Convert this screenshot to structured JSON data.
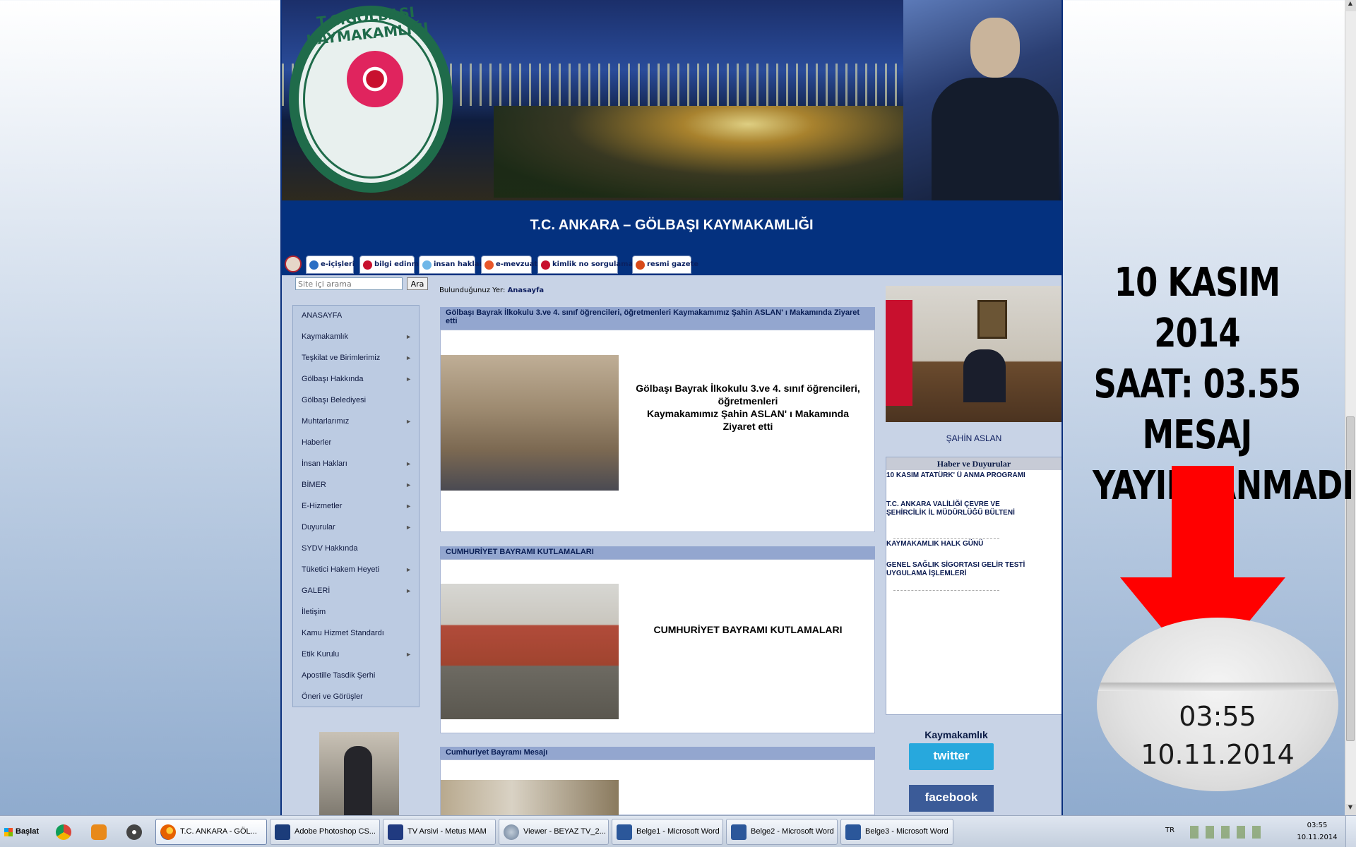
{
  "site": {
    "seal_text": "T.C.GÖLBAŞI KAYMAKAMLIĞI",
    "title": "T.C. ANKARA – GÖLBAŞI KAYMAKAMLIĞI",
    "quick_links": [
      {
        "label": "e-içişleri",
        "color": "#2b6fc4"
      },
      {
        "label": "bilgi edinme",
        "color": "#c8102e"
      },
      {
        "label": "insan hakları",
        "color": "#6fb7e8"
      },
      {
        "label": "e-mevzuat",
        "color": "#e8572a"
      },
      {
        "label": "kimlik no sorgulama",
        "color": "#c8102e"
      },
      {
        "label": "resmi gazete",
        "color": "#d84a1a"
      }
    ],
    "search": {
      "placeholder": "Site içi arama",
      "button": "Ara"
    },
    "menu": [
      {
        "label": "ANASAYFA",
        "arrow": ""
      },
      {
        "label": "Kaymakamlık",
        "arrow": "►"
      },
      {
        "label": "Teşkilat ve Birimlerimiz",
        "arrow": "►"
      },
      {
        "label": "Gölbaşı Hakkında",
        "arrow": "►"
      },
      {
        "label": "Gölbaşı Belediyesi",
        "arrow": ""
      },
      {
        "label": "Muhtarlarımız",
        "arrow": "►"
      },
      {
        "label": "Haberler",
        "arrow": ""
      },
      {
        "label": "İnsan Hakları",
        "arrow": "►"
      },
      {
        "label": "BİMER",
        "arrow": "►"
      },
      {
        "label": "E-Hizmetler",
        "arrow": "►"
      },
      {
        "label": "Duyurular",
        "arrow": "►"
      },
      {
        "label": "SYDV Hakkında",
        "arrow": ""
      },
      {
        "label": "Tüketici Hakem Heyeti",
        "arrow": "►"
      },
      {
        "label": "GALERİ",
        "arrow": "►"
      },
      {
        "label": "İletişim",
        "arrow": ""
      },
      {
        "label": "Kamu Hizmet Standardı",
        "arrow": ""
      },
      {
        "label": "Etik Kurulu",
        "arrow": "►"
      },
      {
        "label": "Apostille Tasdik Şerhi",
        "arrow": ""
      },
      {
        "label": "Öneri ve Görüşler",
        "arrow": ""
      }
    ],
    "breadcrumb": {
      "prefix": "Bulunduğunuz Yer:",
      "current": "Anasayfa"
    },
    "posts": [
      {
        "header": "Gölbaşı Bayrak İlkokulu 3.ve 4. sınıf öğrencileri, öğretmenleri Kaymakamımız Şahin ASLAN' ı Makamında Ziyaret etti",
        "body_lines": [
          "Gölbaşı Bayrak İlkokulu 3.ve 4. sınıf öğrencileri,",
          "öğretmenleri",
          "Kaymakamımız Şahin ASLAN' ı Makamında",
          "Ziyaret etti"
        ]
      },
      {
        "header": "CUMHURİYET BAYRAMI KUTLAMALARI",
        "body_lines": [
          "CUMHURİYET BAYRAMI KUTLAMALARI"
        ]
      },
      {
        "header": "Cumhuriyet Bayramı Mesajı",
        "body_lines": []
      }
    ],
    "official_name": "ŞAHİN ASLAN",
    "news": {
      "title": "Haber ve Duyurular",
      "items": [
        "10 KASIM ATATÜRK' Ü ANMA PROGRAMI",
        "T.C. ANKARA VALİLİĞİ ÇEVRE VE ŞEHİRCİLİK İL MÜDÜRLÜĞÜ BÜLTENİ",
        "KAYMAKAMLIK HALK GÜNÜ",
        "GENEL SAĞLIK SİGORTASI GELİR TESTİ UYGULAMA İŞLEMLERİ"
      ]
    },
    "social": {
      "label": "Kaymakamlık",
      "twitter": "twitter",
      "facebook": "facebook"
    }
  },
  "annotation": {
    "lines": [
      "10 KASIM 2014",
      "SAAT: 03.55",
      "MESAJ",
      "YAYINLANMADI"
    ],
    "arrow_color": "#ff0000",
    "zoom_time": "03:55",
    "zoom_date": "10.11.2014"
  },
  "taskbar": {
    "start_label": "Başlat",
    "pinned": [
      {
        "icon": "chrome-icon",
        "color": "#e0a020"
      },
      {
        "icon": "media-player-icon",
        "color": "#e8891a"
      },
      {
        "icon": "film-reel-icon",
        "color": "#444444"
      }
    ],
    "windows": [
      {
        "label": "T.C. ANKARA - GÖL...",
        "icon": "firefox-icon",
        "color": "#e66000",
        "active": true
      },
      {
        "label": "Adobe Photoshop CS...",
        "icon": "photoshop-icon",
        "color": "#1b3c7a",
        "active": false
      },
      {
        "label": "TV Arsivi - Metus MAM",
        "icon": "metus-icon",
        "color": "#203a80",
        "active": false
      },
      {
        "label": "Viewer - BEYAZ TV_2...",
        "icon": "viewer-icon",
        "color": "#6b7f99",
        "active": false
      },
      {
        "label": "Belge1 - Microsoft Word",
        "icon": "word-icon",
        "color": "#2b579a",
        "active": false
      },
      {
        "label": "Belge2 - Microsoft Word",
        "icon": "word-icon",
        "color": "#2b579a",
        "active": false
      },
      {
        "label": "Belge3 - Microsoft Word",
        "icon": "word-icon",
        "color": "#2b579a",
        "active": false
      }
    ],
    "language": "TR",
    "clock_time": "03:55",
    "clock_date": "10.11.2014"
  }
}
